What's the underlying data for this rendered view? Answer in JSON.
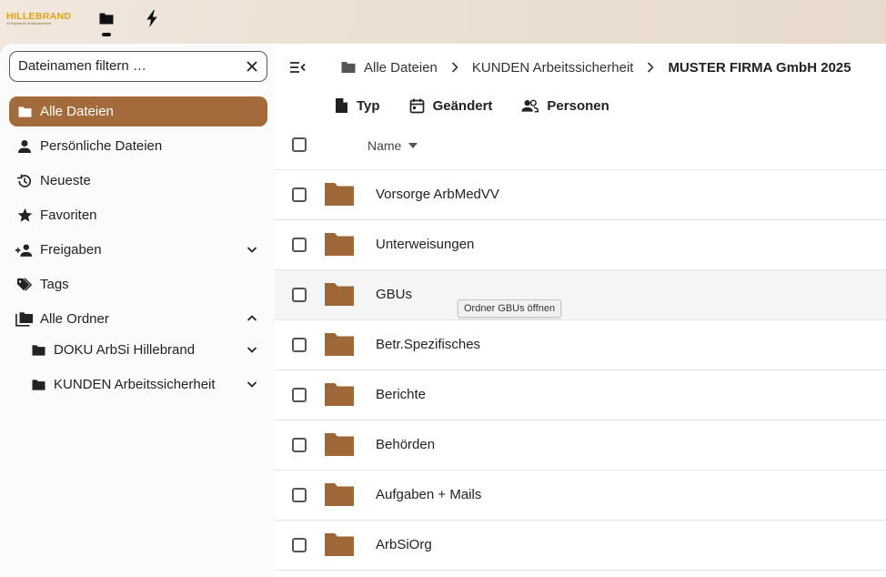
{
  "header": {
    "logo_text": "HILLEBRAND",
    "logo_subtext": "Ihr Experte für Arbeitssicherheit",
    "apps": [
      {
        "name": "Files",
        "icon": "folder-icon"
      },
      {
        "name": "Activity",
        "icon": "lightning-icon"
      }
    ]
  },
  "sidebar": {
    "filter": {
      "placeholder": "Dateinamen filtern …",
      "value": ""
    },
    "items": [
      {
        "label": "Alle Dateien",
        "icon": "folder-icon",
        "active": true
      },
      {
        "label": "Persönliche Dateien",
        "icon": "person-icon"
      },
      {
        "label": "Neueste",
        "icon": "history-icon"
      },
      {
        "label": "Favoriten",
        "icon": "star-icon"
      },
      {
        "label": "Freigaben",
        "icon": "share-person-icon",
        "expandable": true
      },
      {
        "label": "Tags",
        "icon": "tags-icon"
      },
      {
        "label": "Alle Ordner",
        "icon": "folder-multiple-icon",
        "expanded": true
      },
      {
        "label": "DOKU ArbSi Hillebrand",
        "icon": "folder-icon",
        "expandable": true
      },
      {
        "label": "KUNDEN Arbeitssicherheit",
        "icon": "folder-icon",
        "expandable": true
      }
    ]
  },
  "breadcrumbs": [
    "Alle Dateien",
    "KUNDEN Arbeitssicherheit",
    "MUSTER FIRMA GmbH 2025"
  ],
  "filters": [
    {
      "label": "Typ",
      "icon": "file-icon"
    },
    {
      "label": "Geändert",
      "icon": "calendar-icon"
    },
    {
      "label": "Personen",
      "icon": "people-icon"
    }
  ],
  "table": {
    "name_header": "Name",
    "rows": [
      {
        "name": "Vorsorge ArbMedVV"
      },
      {
        "name": "Unterweisungen"
      },
      {
        "name": "GBUs",
        "hover": true
      },
      {
        "name": "Betr.Spezifisches"
      },
      {
        "name": "Berichte"
      },
      {
        "name": "Behörden"
      },
      {
        "name": "Aufgaben + Mails"
      },
      {
        "name": "ArbSiOrg"
      }
    ]
  },
  "tooltip": "Ordner GBUs öffnen",
  "colors": {
    "accent": "#a36a3c",
    "folder": "#9c6637"
  }
}
